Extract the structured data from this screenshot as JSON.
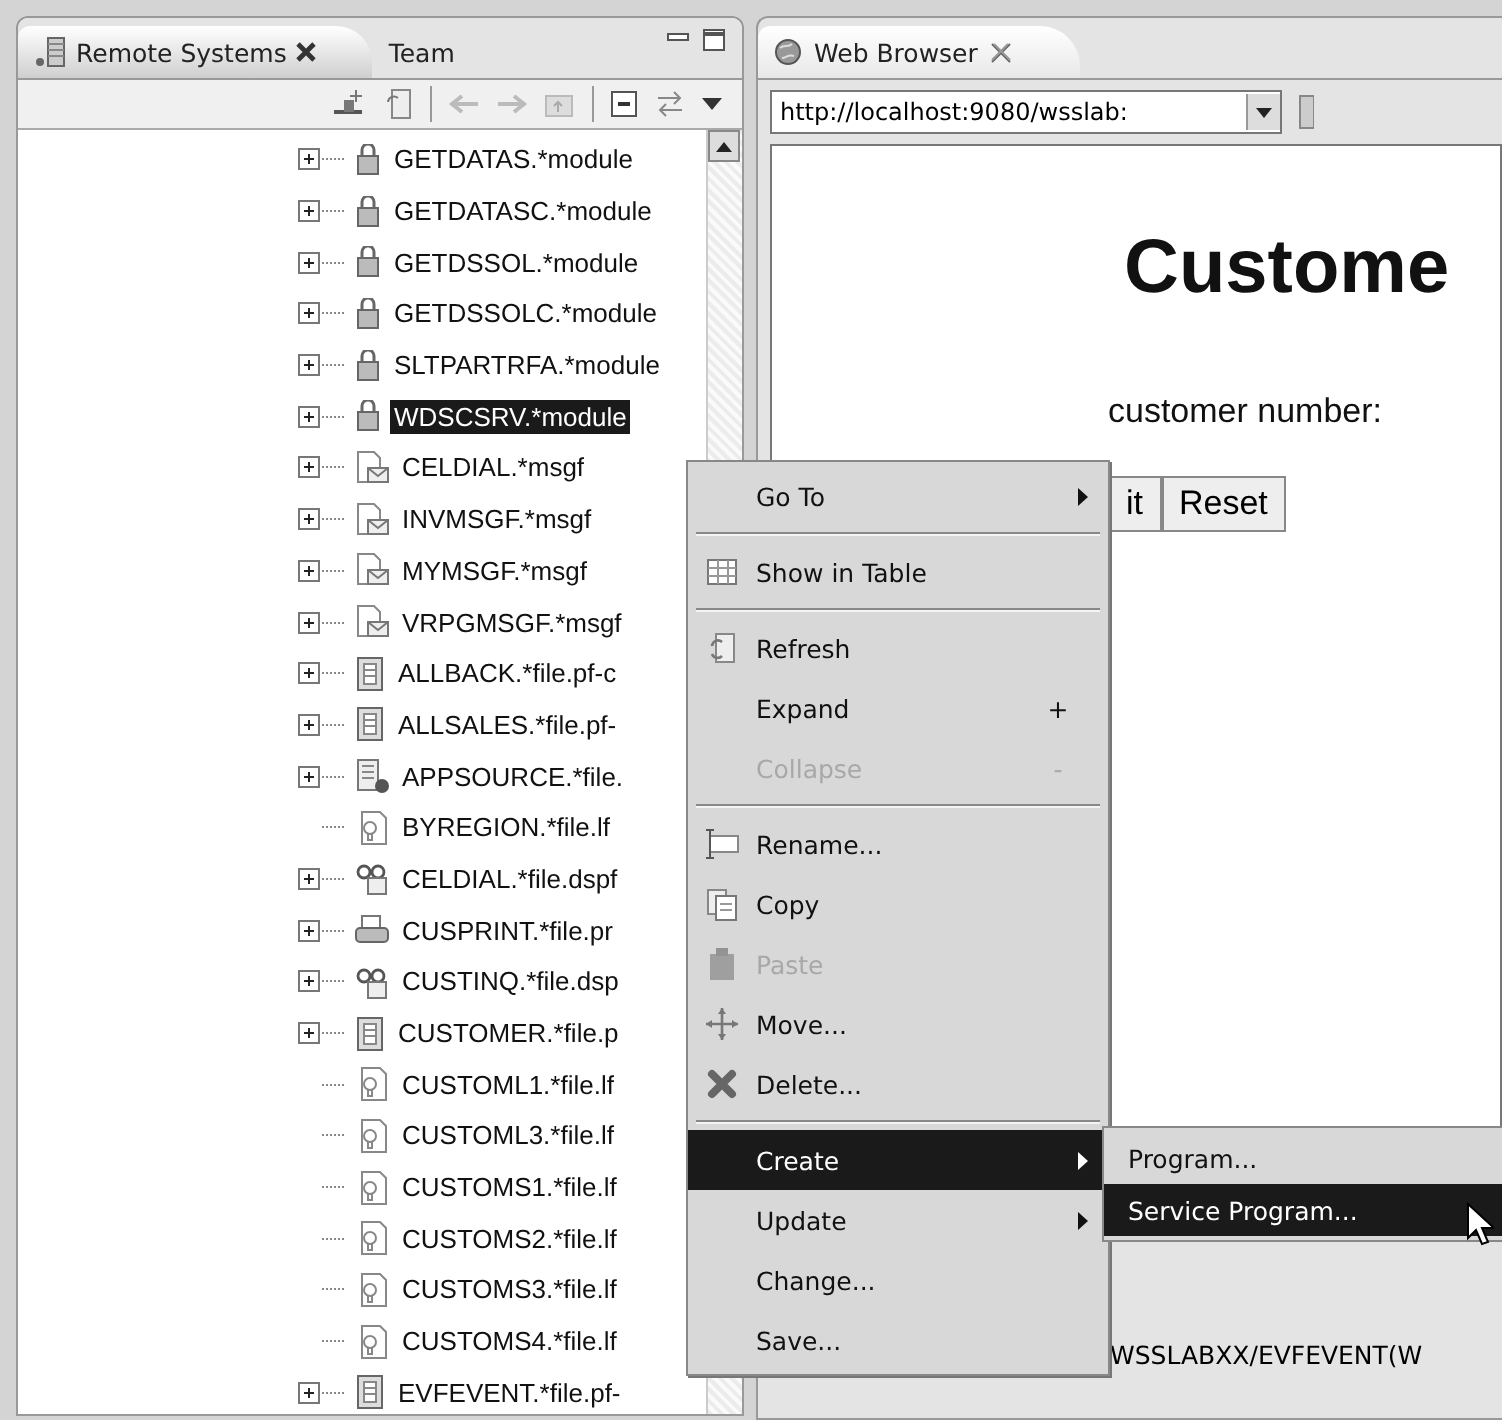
{
  "remote_systems_view": {
    "tabs": [
      {
        "label": "Remote Systems",
        "selected": true,
        "closable": true
      },
      {
        "label": "Team",
        "selected": false,
        "closable": false
      }
    ],
    "tree": {
      "items": [
        {
          "label": "GETDATAS.*module",
          "kind": "module",
          "expandable": true,
          "selected": false
        },
        {
          "label": "GETDATASC.*module",
          "kind": "module",
          "expandable": true,
          "selected": false
        },
        {
          "label": "GETDSSOL.*module",
          "kind": "module",
          "expandable": true,
          "selected": false
        },
        {
          "label": "GETDSSOLC.*module",
          "kind": "module",
          "expandable": true,
          "selected": false
        },
        {
          "label": "SLTPARTRFA.*module",
          "kind": "module",
          "expandable": true,
          "selected": false
        },
        {
          "label": "WDSCSRV.*module",
          "kind": "module",
          "expandable": true,
          "selected": true
        },
        {
          "label": "CELDIAL.*msgf",
          "kind": "msgf",
          "expandable": true,
          "selected": false
        },
        {
          "label": "INVMSGF.*msgf",
          "kind": "msgf",
          "expandable": true,
          "selected": false
        },
        {
          "label": "MYMSGF.*msgf",
          "kind": "msgf",
          "expandable": true,
          "selected": false
        },
        {
          "label": "VRPGMSGF.*msgf",
          "kind": "msgf",
          "expandable": true,
          "selected": false
        },
        {
          "label": "ALLBACK.*file.pf-c",
          "kind": "pf",
          "expandable": true,
          "selected": false
        },
        {
          "label": "ALLSALES.*file.pf-",
          "kind": "pf",
          "expandable": true,
          "selected": false
        },
        {
          "label": "APPSOURCE.*file.",
          "kind": "source",
          "expandable": true,
          "selected": false
        },
        {
          "label": "BYREGION.*file.lf",
          "kind": "lf",
          "expandable": false,
          "selected": false
        },
        {
          "label": "CELDIAL.*file.dspf",
          "kind": "dspf",
          "expandable": true,
          "selected": false
        },
        {
          "label": "CUSPRINT.*file.pr",
          "kind": "prtf",
          "expandable": true,
          "selected": false
        },
        {
          "label": "CUSTINQ.*file.dsp",
          "kind": "dspf",
          "expandable": true,
          "selected": false
        },
        {
          "label": "CUSTOMER.*file.p",
          "kind": "pf",
          "expandable": true,
          "selected": false
        },
        {
          "label": "CUSTOML1.*file.lf",
          "kind": "lf",
          "expandable": false,
          "selected": false
        },
        {
          "label": "CUSTOML3.*file.lf",
          "kind": "lf",
          "expandable": false,
          "selected": false
        },
        {
          "label": "CUSTOMS1.*file.lf",
          "kind": "lf",
          "expandable": false,
          "selected": false
        },
        {
          "label": "CUSTOMS2.*file.lf",
          "kind": "lf",
          "expandable": false,
          "selected": false
        },
        {
          "label": "CUSTOMS3.*file.lf",
          "kind": "lf",
          "expandable": false,
          "selected": false
        },
        {
          "label": "CUSTOMS4.*file.lf",
          "kind": "lf",
          "expandable": false,
          "selected": false
        },
        {
          "label": "EVFEVENT.*file.pf-",
          "kind": "pf",
          "expandable": true,
          "selected": false
        }
      ]
    }
  },
  "browser_view": {
    "tabs": [
      {
        "label": "Web Browser",
        "selected": true
      }
    ],
    "url": "http://localhost:9080/wsslab:",
    "page": {
      "heading": "Custome",
      "prompt": "customer number:",
      "buttons": [
        "it",
        "Reset"
      ]
    },
    "status_text": "WSSLABXX/EVFEVENT(W"
  },
  "context_menu": {
    "items": [
      {
        "kind": "item",
        "label": "Go To",
        "submenu": true,
        "disabled": false,
        "selected": false
      },
      {
        "kind": "separator"
      },
      {
        "kind": "item",
        "label": "Show in Table",
        "submenu": false,
        "disabled": false,
        "selected": false
      },
      {
        "kind": "separator"
      },
      {
        "kind": "item",
        "label": "Refresh",
        "submenu": false,
        "disabled": false,
        "selected": false
      },
      {
        "kind": "item",
        "label": "Expand",
        "shortcut": "+",
        "submenu": false,
        "disabled": false,
        "selected": false
      },
      {
        "kind": "item",
        "label": "Collapse",
        "shortcut": "-",
        "submenu": false,
        "disabled": true,
        "selected": false
      },
      {
        "kind": "separator"
      },
      {
        "kind": "item",
        "label": "Rename...",
        "submenu": false,
        "disabled": false,
        "selected": false
      },
      {
        "kind": "item",
        "label": "Copy",
        "submenu": false,
        "disabled": false,
        "selected": false
      },
      {
        "kind": "item",
        "label": "Paste",
        "submenu": false,
        "disabled": true,
        "selected": false
      },
      {
        "kind": "item",
        "label": "Move...",
        "submenu": false,
        "disabled": false,
        "selected": false
      },
      {
        "kind": "item",
        "label": "Delete...",
        "submenu": false,
        "disabled": false,
        "selected": false
      },
      {
        "kind": "separator"
      },
      {
        "kind": "item",
        "label": "Create",
        "submenu": true,
        "disabled": false,
        "selected": true
      },
      {
        "kind": "item",
        "label": "Update",
        "submenu": true,
        "disabled": false,
        "selected": false
      },
      {
        "kind": "item",
        "label": "Change...",
        "submenu": false,
        "disabled": false,
        "selected": false
      },
      {
        "kind": "item",
        "label": "Save...",
        "submenu": false,
        "disabled": false,
        "selected": false
      }
    ]
  },
  "submenu": {
    "items": [
      {
        "label": "Program...",
        "selected": false
      },
      {
        "label": "Service Program...",
        "selected": true
      }
    ]
  }
}
